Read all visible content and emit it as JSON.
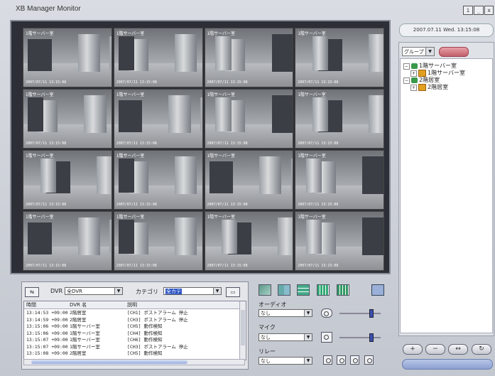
{
  "window": {
    "title": "XB Manager Monitor",
    "buttons": [
      "i",
      "_",
      "□",
      "x"
    ]
  },
  "datetime": "2007.07.11  Wed.  13:15:08",
  "cameras": [
    {
      "label": "1階サーバー室",
      "time": "2007/07/11 13:15:08"
    },
    {
      "label": "1階サーバー室",
      "time": "2007/07/11 13:15:08"
    },
    {
      "label": "1階サーバー室",
      "time": "2007/07/11 13:15:08"
    },
    {
      "label": "1階サーバー室",
      "time": "2007/07/11 13:15:08"
    },
    {
      "label": "1階サーバー室",
      "time": "2007/07/11 13:15:08"
    },
    {
      "label": "1階サーバー室",
      "time": "2007/07/11 13:15:08"
    },
    {
      "label": "1階サーバー室",
      "time": "2007/07/11 13:15:08"
    },
    {
      "label": "1階サーバー室",
      "time": "2007/07/11 13:15:08"
    },
    {
      "label": "1階サーバー室",
      "time": "2007/07/11 13:15:08"
    },
    {
      "label": "1階サーバー室",
      "time": "2007/07/11 13:15:08"
    },
    {
      "label": "1階サーバー室",
      "time": "2007/07/11 13:15:08"
    },
    {
      "label": "1階サーバー室",
      "time": "2007/07/11 13:15:08"
    },
    {
      "label": "1階サーバー室",
      "time": "2007/07/11 13:15:08"
    },
    {
      "label": "1階サーバー室",
      "time": "2007/07/11 13:15:08"
    },
    {
      "label": "1階サーバー室",
      "time": "2007/07/11 13:15:08"
    },
    {
      "label": "1階サーバー室",
      "time": "2007/07/11 13:15:08"
    }
  ],
  "right_panel": {
    "group_select": "グループ",
    "pill_button": "",
    "tree": [
      {
        "label": "1階サーバー室",
        "level": 0,
        "icon": "folder-icon"
      },
      {
        "label": "1階サーバー室",
        "level": 1,
        "icon": "dvr-icon"
      },
      {
        "label": "2階居室",
        "level": 0,
        "icon": "folder-icon"
      },
      {
        "label": "2階居室",
        "level": 1,
        "icon": "dvr-icon"
      }
    ],
    "nav_buttons": [
      "+",
      "−",
      "↔",
      "↻"
    ]
  },
  "log_panel": {
    "dvr_label": "DVR",
    "dvr_value": "全DVR",
    "category_label": "カテゴリ",
    "category_value": "全カテ",
    "columns": [
      "時間",
      "DVR 名",
      "説明"
    ],
    "rows": [
      [
        "13:14:53 +09:00",
        "2階居室",
        "[CH1] ポストアラーム 停止"
      ],
      [
        "13:14:59 +09:00",
        "2階居室",
        "[CH3] ポストアラーム 停止"
      ],
      [
        "13:15:06 +09:00",
        "1階サーバー室",
        "[CH5] 動作検知"
      ],
      [
        "13:15:06 +09:00",
        "1階サーバー室",
        "[CH4] 動作検知"
      ],
      [
        "13:15:07 +09:00",
        "1階サーバー室",
        "[CH6] 動作検知"
      ],
      [
        "13:15:07 +09:00",
        "1階サーバー室",
        "[CH3] ポストアラーム 停止"
      ],
      [
        "13:15:08 +09:00",
        "2階居室",
        "[CH5] 動作検知"
      ]
    ]
  },
  "controls": {
    "audio_label": "オーディオ",
    "audio_value": "なし",
    "mic_label": "マイク",
    "mic_value": "なし",
    "relay_label": "リレー",
    "relay_value": "なし"
  }
}
